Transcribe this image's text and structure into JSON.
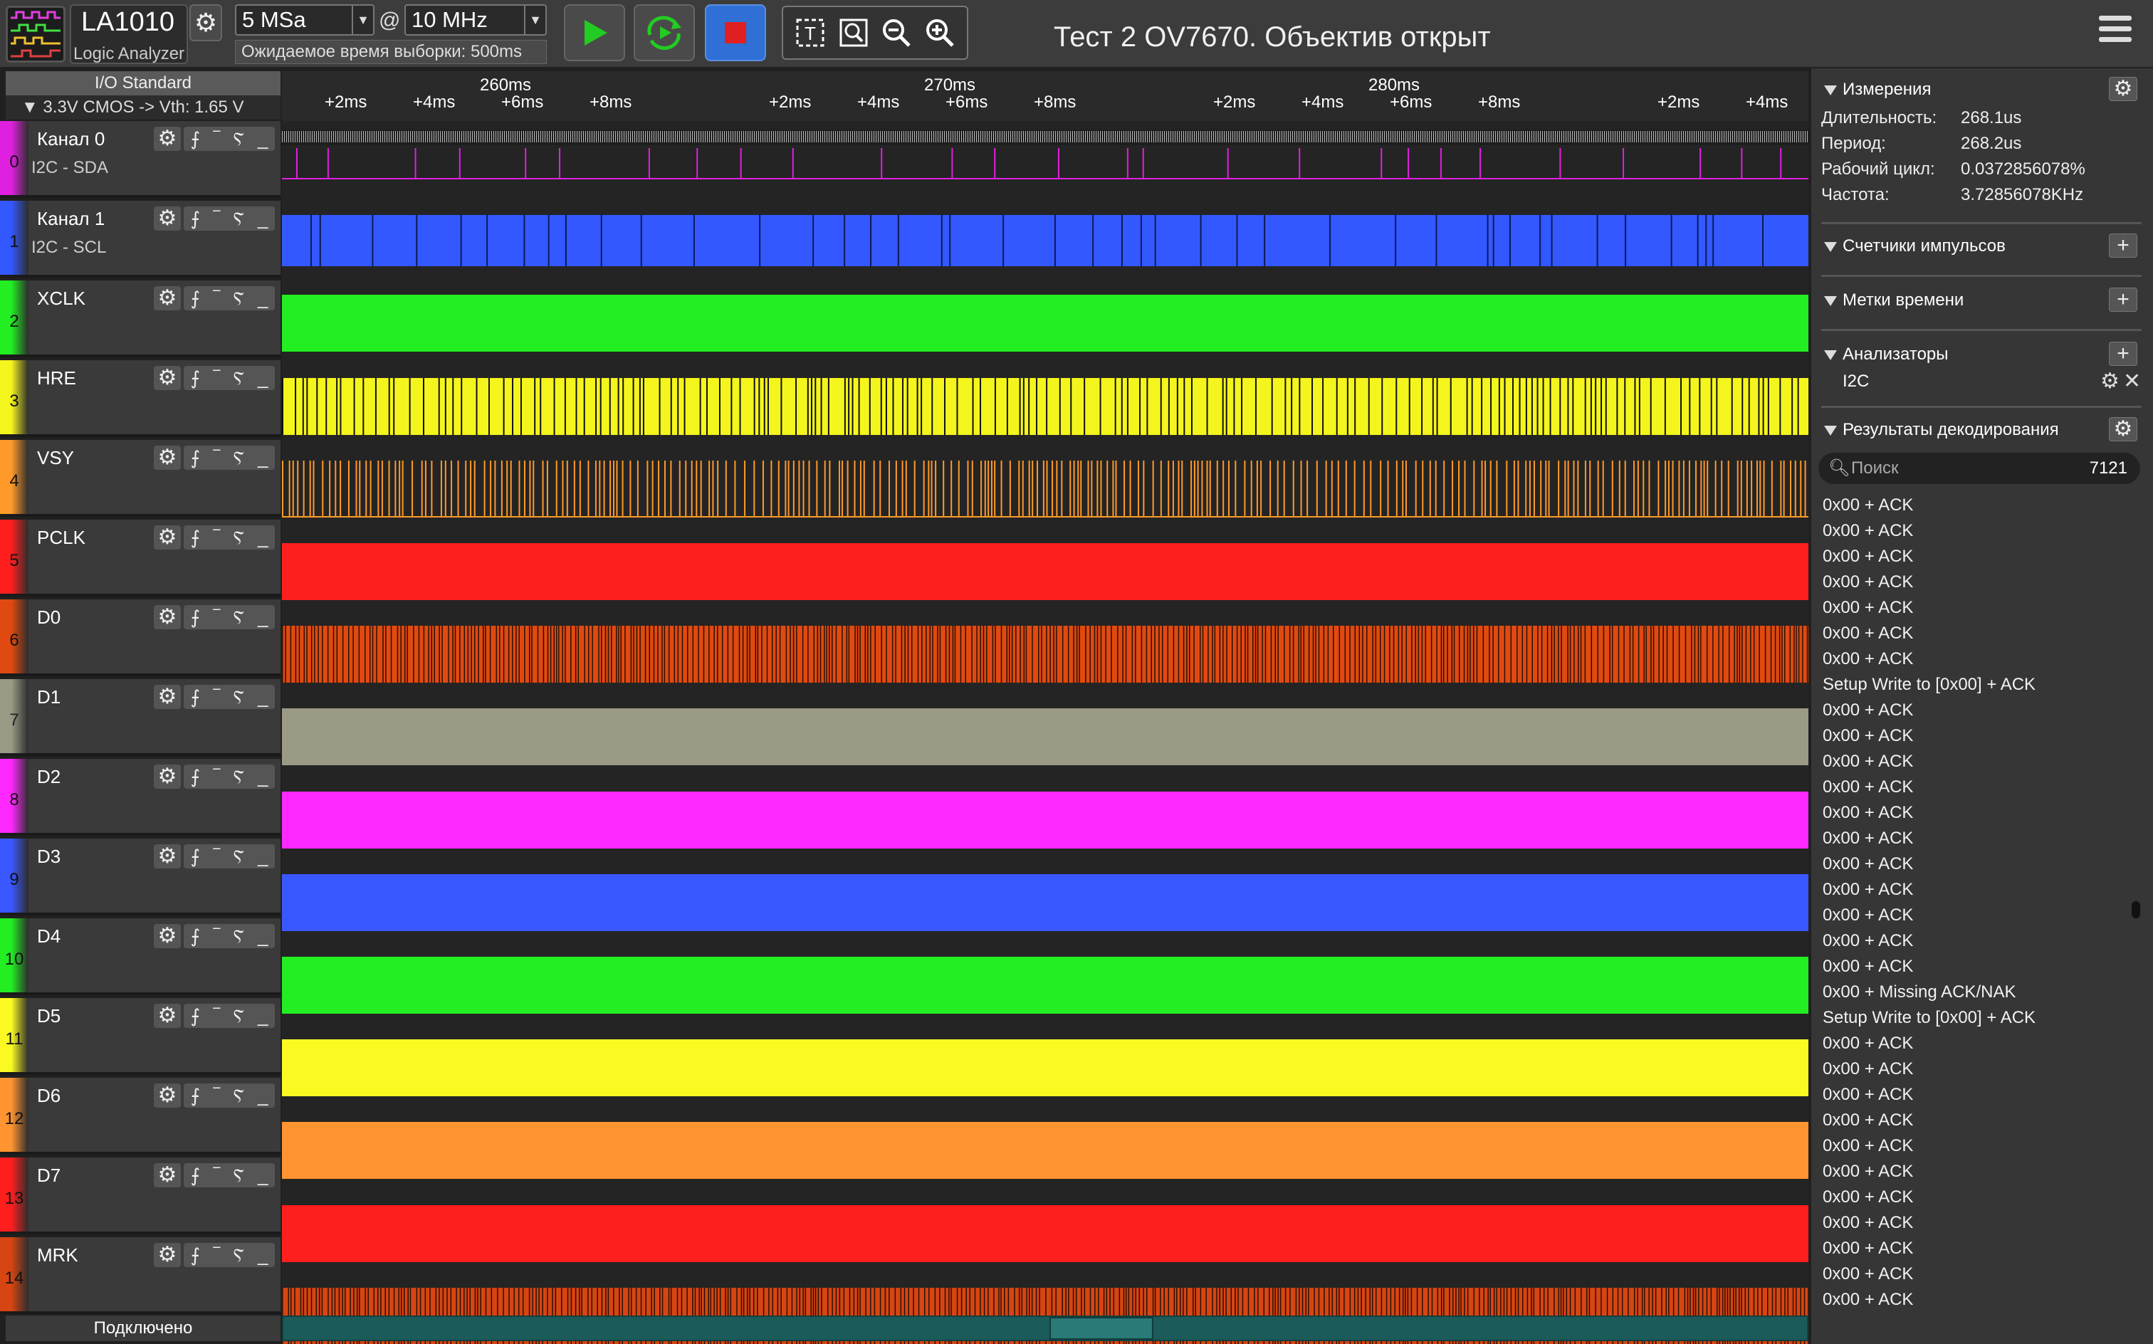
{
  "app": {
    "device": "LA1010",
    "device_sub": "Logic Analyzer",
    "sample_count": "5 MSa",
    "at": "@",
    "sample_rate": "10 MHz",
    "expected_time": "Ожидаемое время выборки: 500ms",
    "window_title": "Тест 2 OV7670. Объектив открыт"
  },
  "io": {
    "header": "I/O Standard",
    "standard": "▼ 3.3V CMOS  -> Vth: 1.65 V"
  },
  "channels": [
    {
      "num": "0",
      "name": "Канал 0",
      "sub": "I2C - SDA",
      "color": "#e020e0",
      "pattern": "sparse"
    },
    {
      "num": "1",
      "name": "Канал 1",
      "sub": "I2C - SCL",
      "color": "#3358ff",
      "pattern": "bluegaps"
    },
    {
      "num": "2",
      "name": "XCLK",
      "sub": "",
      "color": "#22ee22",
      "pattern": "solid"
    },
    {
      "num": "3",
      "name": "HRE",
      "sub": "",
      "color": "#f5f51e",
      "pattern": "dense"
    },
    {
      "num": "4",
      "name": "VSY",
      "sub": "",
      "color": "#ff9a2a",
      "pattern": "vsy"
    },
    {
      "num": "5",
      "name": "PCLK",
      "sub": "",
      "color": "#ff1e1e",
      "pattern": "solid"
    },
    {
      "num": "6",
      "name": "D0",
      "sub": "",
      "color": "#e04a10",
      "pattern": "verydense"
    },
    {
      "num": "7",
      "name": "D1",
      "sub": "",
      "color": "#9a9a85",
      "pattern": "solid"
    },
    {
      "num": "8",
      "name": "D2",
      "sub": "",
      "color": "#ff28ff",
      "pattern": "solid"
    },
    {
      "num": "9",
      "name": "D3",
      "sub": "",
      "color": "#3a58ff",
      "pattern": "solid"
    },
    {
      "num": "10",
      "name": "D4",
      "sub": "",
      "color": "#22ee22",
      "pattern": "solid"
    },
    {
      "num": "11",
      "name": "D5",
      "sub": "",
      "color": "#fafa22",
      "pattern": "solid"
    },
    {
      "num": "12",
      "name": "D6",
      "sub": "",
      "color": "#ff9430",
      "pattern": "solid"
    },
    {
      "num": "13",
      "name": "D7",
      "sub": "",
      "color": "#ff1e1e",
      "pattern": "solid"
    },
    {
      "num": "14",
      "name": "MRK",
      "sub": "",
      "color": "#d64512",
      "pattern": "verydense"
    }
  ],
  "ruler": {
    "ticks": [
      "+2ms",
      "+4ms",
      "+6ms",
      "+8ms",
      "+2ms",
      "+4ms",
      "+6ms",
      "+8ms",
      "+2ms",
      "+4ms",
      "+6ms",
      "+8ms",
      "+2ms",
      "+4ms"
    ],
    "majors": [
      "260ms",
      "270ms",
      "280ms"
    ]
  },
  "status": "Подключено",
  "panel": {
    "measurements": {
      "title": "Измерения",
      "items": [
        {
          "k": "Длительность:",
          "v": "268.1us"
        },
        {
          "k": "Период:",
          "v": "268.2us"
        },
        {
          "k": "Рабочий цикл:",
          "v": "0.0372856078%"
        },
        {
          "k": "Частота:",
          "v": "3.72856078KHz"
        }
      ]
    },
    "counters_title": "Счетчики импульсов",
    "timestamps_title": "Метки времени",
    "analyzers_title": "Анализаторы",
    "analyzer_item": "I2C",
    "decode_title": "Результаты декодирования",
    "search_placeholder": "Поиск",
    "search_count": "7121",
    "results": [
      "0x00 + ACK",
      "0x00 + ACK",
      "0x00 + ACK",
      "0x00 + ACK",
      "0x00 + ACK",
      "0x00 + ACK",
      "0x00 + ACK",
      "Setup Write to [0x00] + ACK",
      "0x00 + ACK",
      "0x00 + ACK",
      "0x00 + ACK",
      "0x00 + ACK",
      "0x00 + ACK",
      "0x00 + ACK",
      "0x00 + ACK",
      "0x00 + ACK",
      "0x00 + ACK",
      "0x00 + ACK",
      "0x00 + ACK",
      "0x00 + Missing ACK/NAK",
      "Setup Write to [0x00] + ACK",
      "0x00 + ACK",
      "0x00 + ACK",
      "0x00 + ACK",
      "0x00 + ACK",
      "0x00 + ACK",
      "0x00 + ACK",
      "0x00 + ACK",
      "0x00 + ACK",
      "0x00 + ACK",
      "0x00 + ACK",
      "0x00 + ACK"
    ]
  }
}
